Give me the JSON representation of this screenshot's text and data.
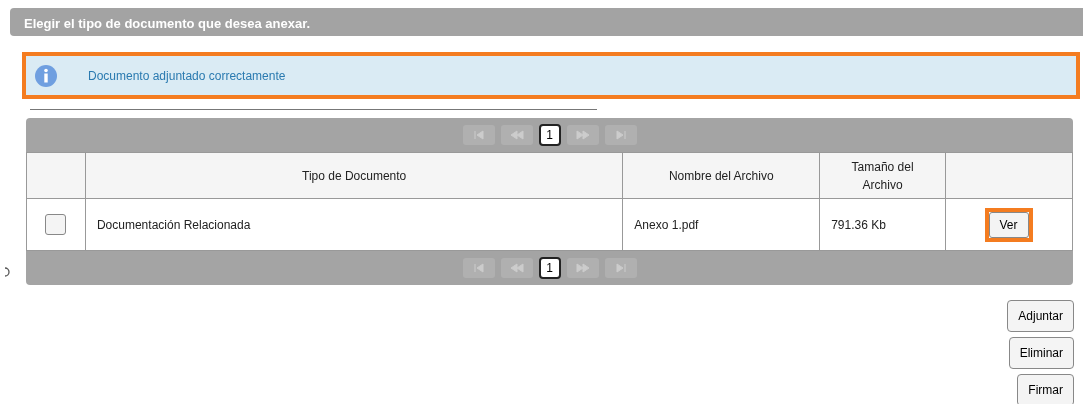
{
  "header": {
    "title": "Elegir el tipo de documento que desea anexar."
  },
  "message": {
    "text": "Documento adjuntado correctamente",
    "highlighted": true
  },
  "pager_top": {
    "pages": [
      {
        "label": "1",
        "selected": true
      }
    ],
    "nav_disabled": true
  },
  "table": {
    "columns": [
      "",
      "Tipo de Documento",
      "Nombre del Archivo",
      "Tamaño del Archivo",
      ""
    ],
    "rows": [
      {
        "checked": false,
        "type": "Documentación Relacionada",
        "file": "Anexo 1.pdf",
        "size": "791.36 Kb",
        "action": {
          "label": "Ver",
          "highlighted": true
        }
      }
    ]
  },
  "pager_bottom": {
    "pages": [
      {
        "label": "1",
        "selected": true
      }
    ],
    "nav_disabled": true
  },
  "buttons": [
    "Adjuntar",
    "Eliminar",
    "Firmar"
  ]
}
